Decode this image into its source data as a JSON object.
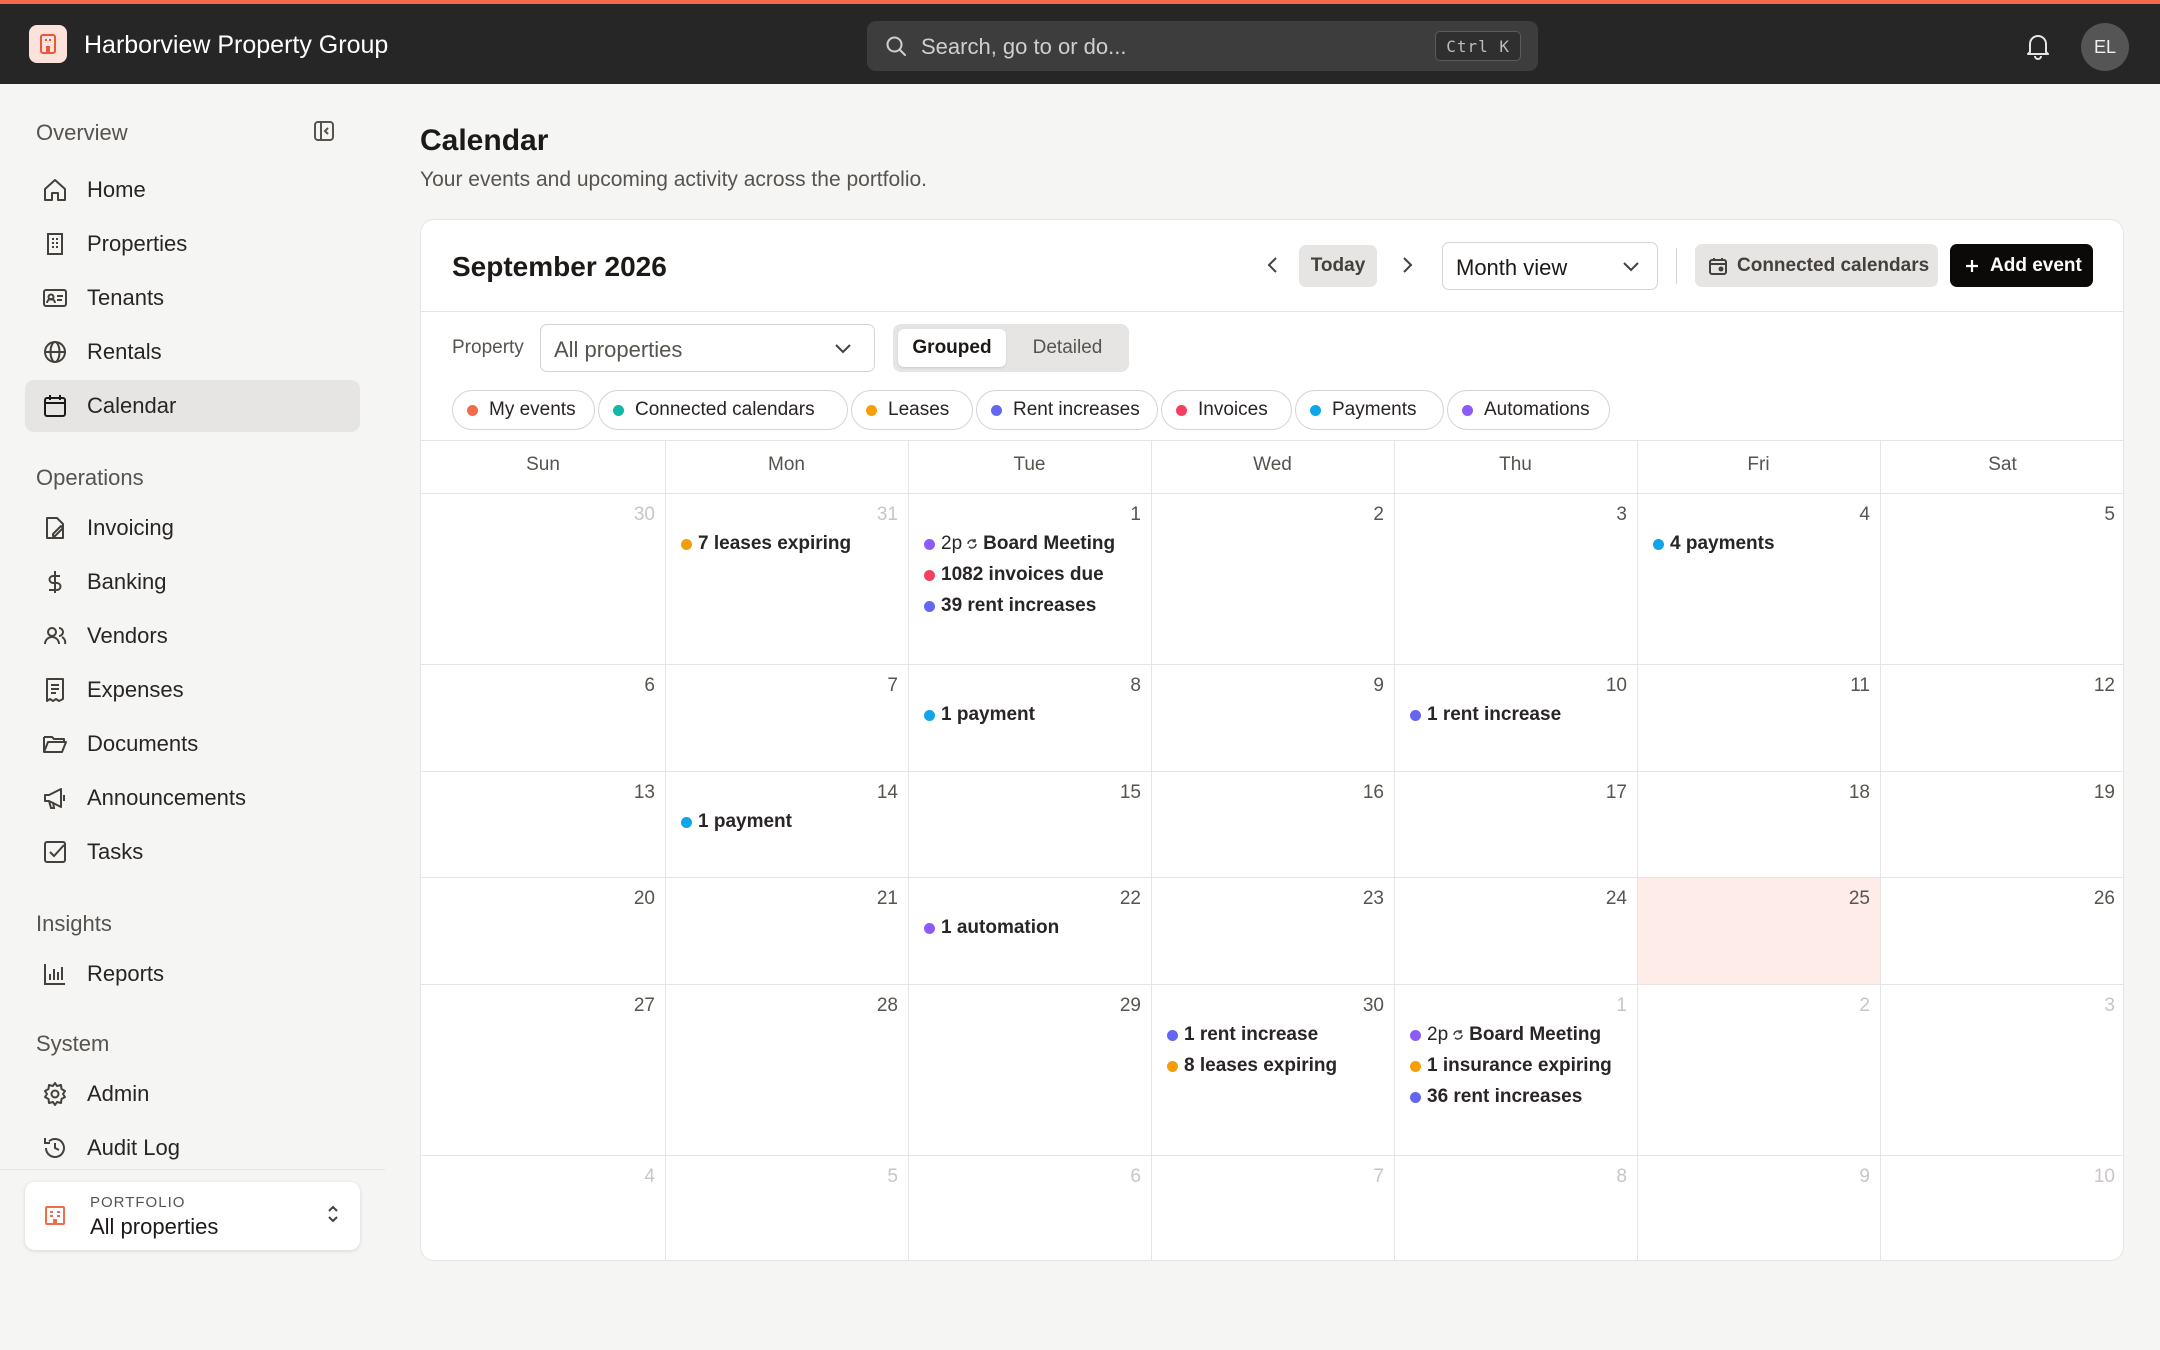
{
  "app": {
    "name": "Harborview Property Group",
    "search_placeholder": "Search, go to or do...",
    "search_shortcut": "Ctrl K",
    "user_initials": "EL",
    "accent": "#f26b4a"
  },
  "sidebar": {
    "sections": [
      {
        "title": "Overview",
        "items": [
          {
            "label": "Home",
            "icon": "home-icon"
          },
          {
            "label": "Properties",
            "icon": "building-icon"
          },
          {
            "label": "Tenants",
            "icon": "id-card-icon"
          },
          {
            "label": "Rentals",
            "icon": "globe-icon"
          },
          {
            "label": "Calendar",
            "icon": "calendar-icon",
            "active": true
          }
        ]
      },
      {
        "title": "Operations",
        "items": [
          {
            "label": "Invoicing",
            "icon": "invoice-icon"
          },
          {
            "label": "Banking",
            "icon": "dollar-icon"
          },
          {
            "label": "Vendors",
            "icon": "users-icon"
          },
          {
            "label": "Expenses",
            "icon": "receipt-icon"
          },
          {
            "label": "Documents",
            "icon": "folder-icon"
          },
          {
            "label": "Announcements",
            "icon": "megaphone-icon"
          },
          {
            "label": "Tasks",
            "icon": "checkbox-icon"
          }
        ]
      },
      {
        "title": "Insights",
        "items": [
          {
            "label": "Reports",
            "icon": "bar-chart-icon"
          }
        ]
      },
      {
        "title": "System",
        "items": [
          {
            "label": "Admin",
            "icon": "gear-icon"
          },
          {
            "label": "Audit Log",
            "icon": "history-icon"
          }
        ]
      }
    ],
    "portfolio": {
      "caption": "PORTFOLIO",
      "value": "All properties"
    }
  },
  "page": {
    "title": "Calendar",
    "subtitle": "Your events and upcoming activity across the portfolio."
  },
  "calendar": {
    "month_label": "September 2026",
    "today_label": "Today",
    "view_select": "Month view",
    "connected_button": "Connected calendars",
    "add_button": "Add event",
    "property_label": "Property",
    "property_select": "All properties",
    "segment": {
      "grouped": "Grouped",
      "detailed": "Detailed",
      "selected": "Grouped"
    },
    "legend": [
      {
        "label": "My events",
        "color": "#f26b4a"
      },
      {
        "label": "Connected calendars",
        "color": "#14b8a6"
      },
      {
        "label": "Leases",
        "color": "#f59e0b"
      },
      {
        "label": "Rent increases",
        "color": "#6366f1"
      },
      {
        "label": "Invoices",
        "color": "#f43f5e"
      },
      {
        "label": "Payments",
        "color": "#0ea5e9"
      },
      {
        "label": "Automations",
        "color": "#8b5cf6"
      }
    ],
    "weekdays": [
      "Sun",
      "Mon",
      "Tue",
      "Wed",
      "Thu",
      "Fri",
      "Sat"
    ],
    "weeks": [
      [
        {
          "day": "30",
          "muted": true,
          "events": []
        },
        {
          "day": "31",
          "muted": true,
          "events": [
            {
              "text": "7 leases expiring",
              "color": "#f59e0b"
            }
          ]
        },
        {
          "day": "1",
          "events": [
            {
              "time": "2p",
              "sync": true,
              "text": "Board Meeting",
              "color": "#8b5cf6"
            },
            {
              "text": "1082 invoices due",
              "color": "#f43f5e"
            },
            {
              "text": "39 rent increases",
              "color": "#6366f1"
            }
          ]
        },
        {
          "day": "2",
          "events": []
        },
        {
          "day": "3",
          "events": []
        },
        {
          "day": "4",
          "events": [
            {
              "text": "4 payments",
              "color": "#0ea5e9"
            }
          ]
        },
        {
          "day": "5",
          "events": []
        }
      ],
      [
        {
          "day": "6",
          "events": []
        },
        {
          "day": "7",
          "events": []
        },
        {
          "day": "8",
          "events": [
            {
              "text": "1 payment",
              "color": "#0ea5e9"
            }
          ]
        },
        {
          "day": "9",
          "events": []
        },
        {
          "day": "10",
          "events": [
            {
              "text": "1 rent increase",
              "color": "#6366f1"
            }
          ]
        },
        {
          "day": "11",
          "events": []
        },
        {
          "day": "12",
          "events": []
        }
      ],
      [
        {
          "day": "13",
          "events": []
        },
        {
          "day": "14",
          "events": [
            {
              "text": "1 payment",
              "color": "#0ea5e9"
            }
          ]
        },
        {
          "day": "15",
          "events": []
        },
        {
          "day": "16",
          "events": []
        },
        {
          "day": "17",
          "events": []
        },
        {
          "day": "18",
          "events": []
        },
        {
          "day": "19",
          "events": []
        }
      ],
      [
        {
          "day": "20",
          "events": []
        },
        {
          "day": "21",
          "events": []
        },
        {
          "day": "22",
          "events": [
            {
              "text": "1 automation",
              "color": "#8b5cf6"
            }
          ]
        },
        {
          "day": "23",
          "events": []
        },
        {
          "day": "24",
          "events": []
        },
        {
          "day": "25",
          "today": true,
          "events": []
        },
        {
          "day": "26",
          "events": []
        }
      ],
      [
        {
          "day": "27",
          "events": []
        },
        {
          "day": "28",
          "events": []
        },
        {
          "day": "29",
          "events": []
        },
        {
          "day": "30",
          "events": [
            {
              "text": "1 rent increase",
              "color": "#6366f1"
            },
            {
              "text": "8 leases expiring",
              "color": "#f59e0b"
            }
          ]
        },
        {
          "day": "1",
          "muted": true,
          "events": [
            {
              "time": "2p",
              "sync": true,
              "text": "Board Meeting",
              "color": "#8b5cf6"
            },
            {
              "text": "1 insurance expiring",
              "color": "#f59e0b"
            },
            {
              "text": "36 rent increases",
              "color": "#6366f1"
            }
          ]
        },
        {
          "day": "2",
          "muted": true,
          "events": []
        },
        {
          "day": "3",
          "muted": true,
          "events": []
        }
      ],
      [
        {
          "day": "4",
          "muted": true,
          "events": []
        },
        {
          "day": "5",
          "muted": true,
          "events": []
        },
        {
          "day": "6",
          "muted": true,
          "events": []
        },
        {
          "day": "7",
          "muted": true,
          "events": []
        },
        {
          "day": "8",
          "muted": true,
          "events": []
        },
        {
          "day": "9",
          "muted": true,
          "events": []
        },
        {
          "day": "10",
          "muted": true,
          "events": []
        }
      ]
    ]
  }
}
